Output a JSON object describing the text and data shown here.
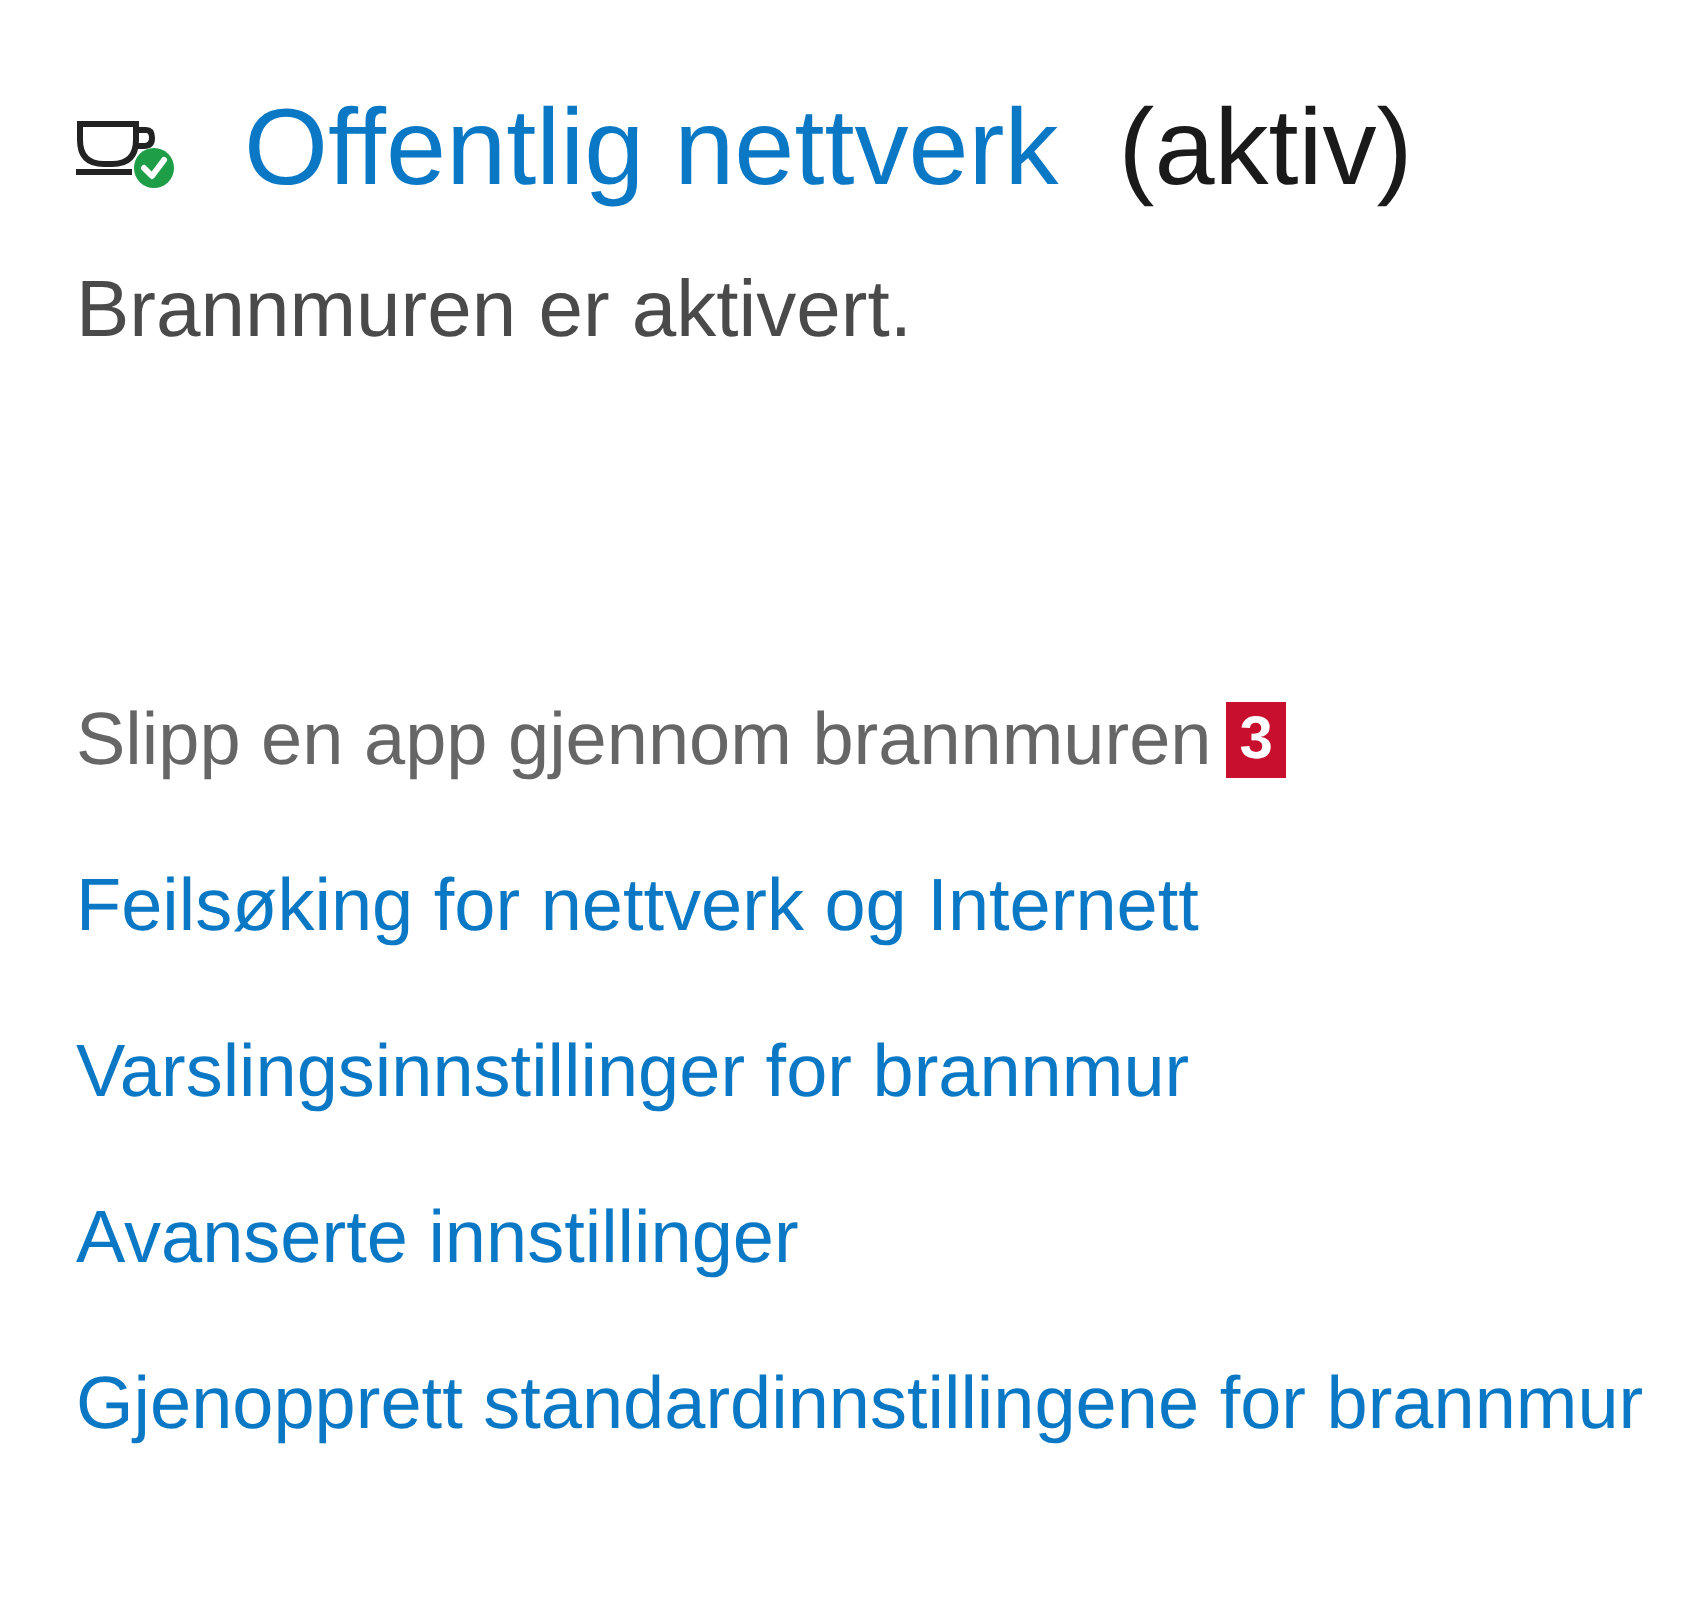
{
  "network": {
    "title": "Offentlig nettverk",
    "status": "(aktiv)"
  },
  "firewall_status": "Brannmuren er aktivert.",
  "links": [
    {
      "label": "Slipp en app gjennom brannmuren",
      "disabled": true,
      "badge": "3"
    },
    {
      "label": "Feilsøking for nettverk og Internett",
      "disabled": false
    },
    {
      "label": "Varslingsinnstillinger for brannmur",
      "disabled": false
    },
    {
      "label": "Avanserte innstillinger",
      "disabled": false
    },
    {
      "label": "Gjenopprett standardinnstillingene for brannmur",
      "disabled": false
    }
  ]
}
